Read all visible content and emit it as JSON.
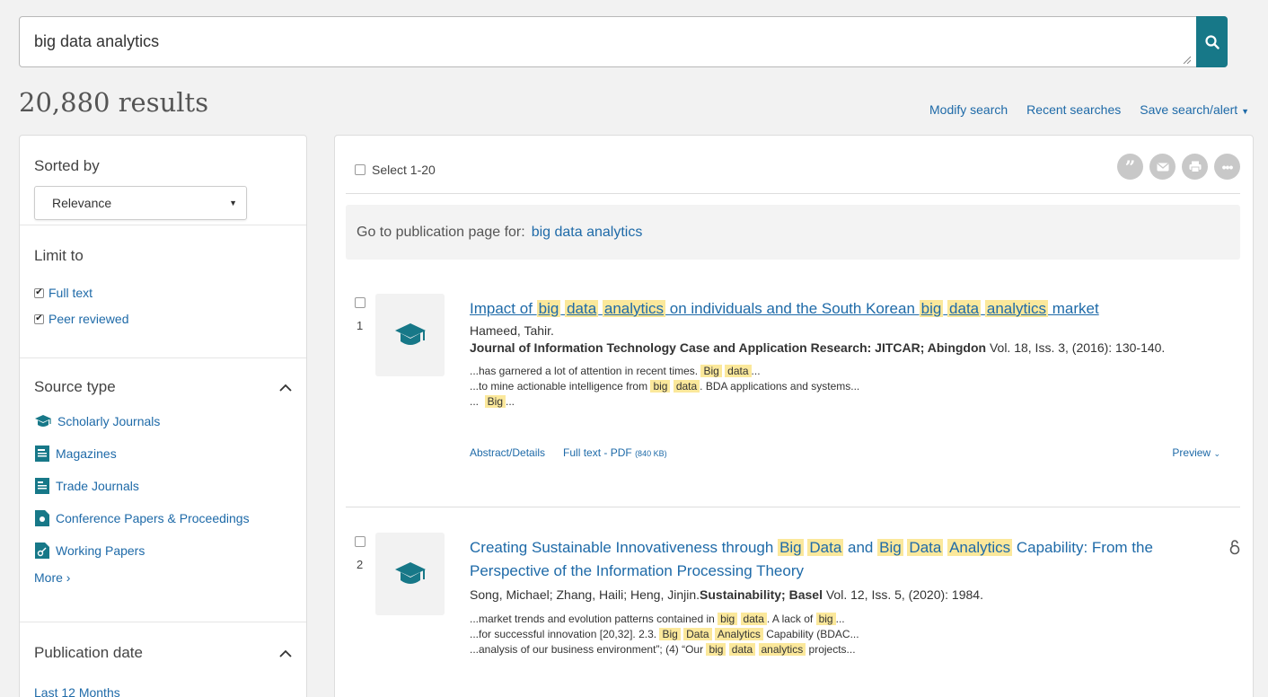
{
  "search": {
    "query": "big data analytics"
  },
  "header": {
    "results_count": "20,880 results",
    "modify_search": "Modify search",
    "recent_searches": "Recent searches",
    "save_search": "Save search/alert"
  },
  "sidebar": {
    "sorted_by_label": "Sorted by",
    "sort_value": "Relevance",
    "limit_to_label": "Limit to",
    "limits": [
      {
        "label": "Full text",
        "checked": true
      },
      {
        "label": "Peer reviewed",
        "checked": true
      }
    ],
    "source_type_label": "Source type",
    "source_types": [
      {
        "label": "Scholarly Journals",
        "icon": "mortarboard-icon"
      },
      {
        "label": "Magazines",
        "icon": "magazine-icon"
      },
      {
        "label": "Trade Journals",
        "icon": "trade-journal-icon"
      },
      {
        "label": "Conference Papers & Proceedings",
        "icon": "conference-paper-icon"
      },
      {
        "label": "Working Papers",
        "icon": "working-paper-icon"
      }
    ],
    "more_label": "More ›",
    "publication_date_label": "Publication date",
    "last_12_months": "Last 12 Months"
  },
  "main": {
    "select_label": "Select 1-20",
    "action_icons": [
      "cite-icon",
      "email-icon",
      "print-icon",
      "more-icon"
    ],
    "pub_page_prefix": "Go to publication page for:",
    "pub_page_link": "big data analytics",
    "results": [
      {
        "number": "1",
        "authors": "Hameed, Tahir.",
        "journal_bold": "Journal of Information Technology Case and Application Research: JITCAR; Abingdon",
        "journal_rest": " Vol. 18, Iss. 3,  (2016): 130-140.",
        "abstract_link": "Abstract/Details",
        "fulltext_link": "Full text - PDF",
        "fulltext_size": "(840 KB)",
        "preview": "Preview"
      },
      {
        "number": "2",
        "authors": "Song, Michael; Zhang, Haili; Heng, Jinjin.",
        "journal_bold": "Sustainability; Basel",
        "journal_rest": " Vol. 12, Iss. 5,  (2020): 1984."
      }
    ]
  },
  "colors": {
    "accent": "#177888",
    "link": "#1e6aa8",
    "highlight": "#fbe89b",
    "icon_grey": "#c8c8c8"
  }
}
